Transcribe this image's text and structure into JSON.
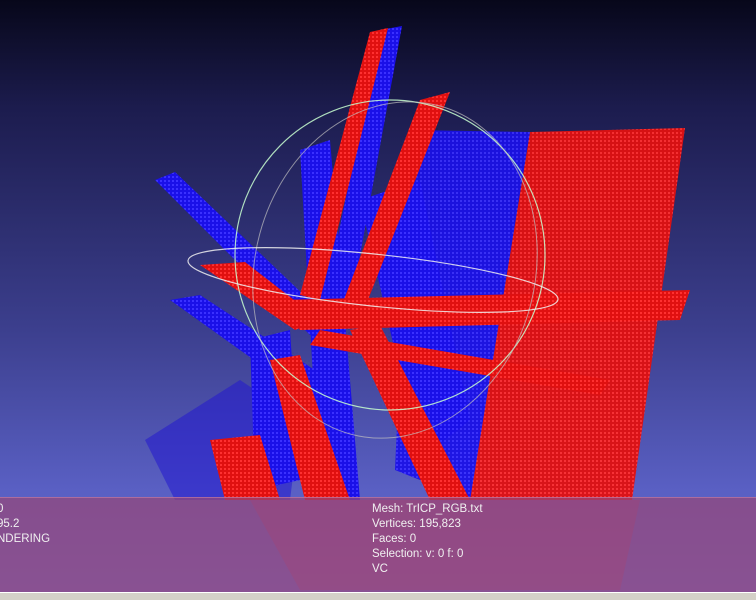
{
  "colors": {
    "cloud_a": "#ff1010",
    "cloud_b": "#1a10ff",
    "trackball": "#c8ffd0",
    "info_panel": "#964678"
  },
  "info_left": {
    "line1": "0",
    "line2": "95.2",
    "line3": "NDERING"
  },
  "info_mesh": {
    "mesh": "Mesh: TrICP_RGB.txt",
    "vertices": "Vertices: 195,823",
    "faces": "Faces: 0",
    "selection": "Selection: v: 0 f: 0",
    "mode": "VC"
  }
}
